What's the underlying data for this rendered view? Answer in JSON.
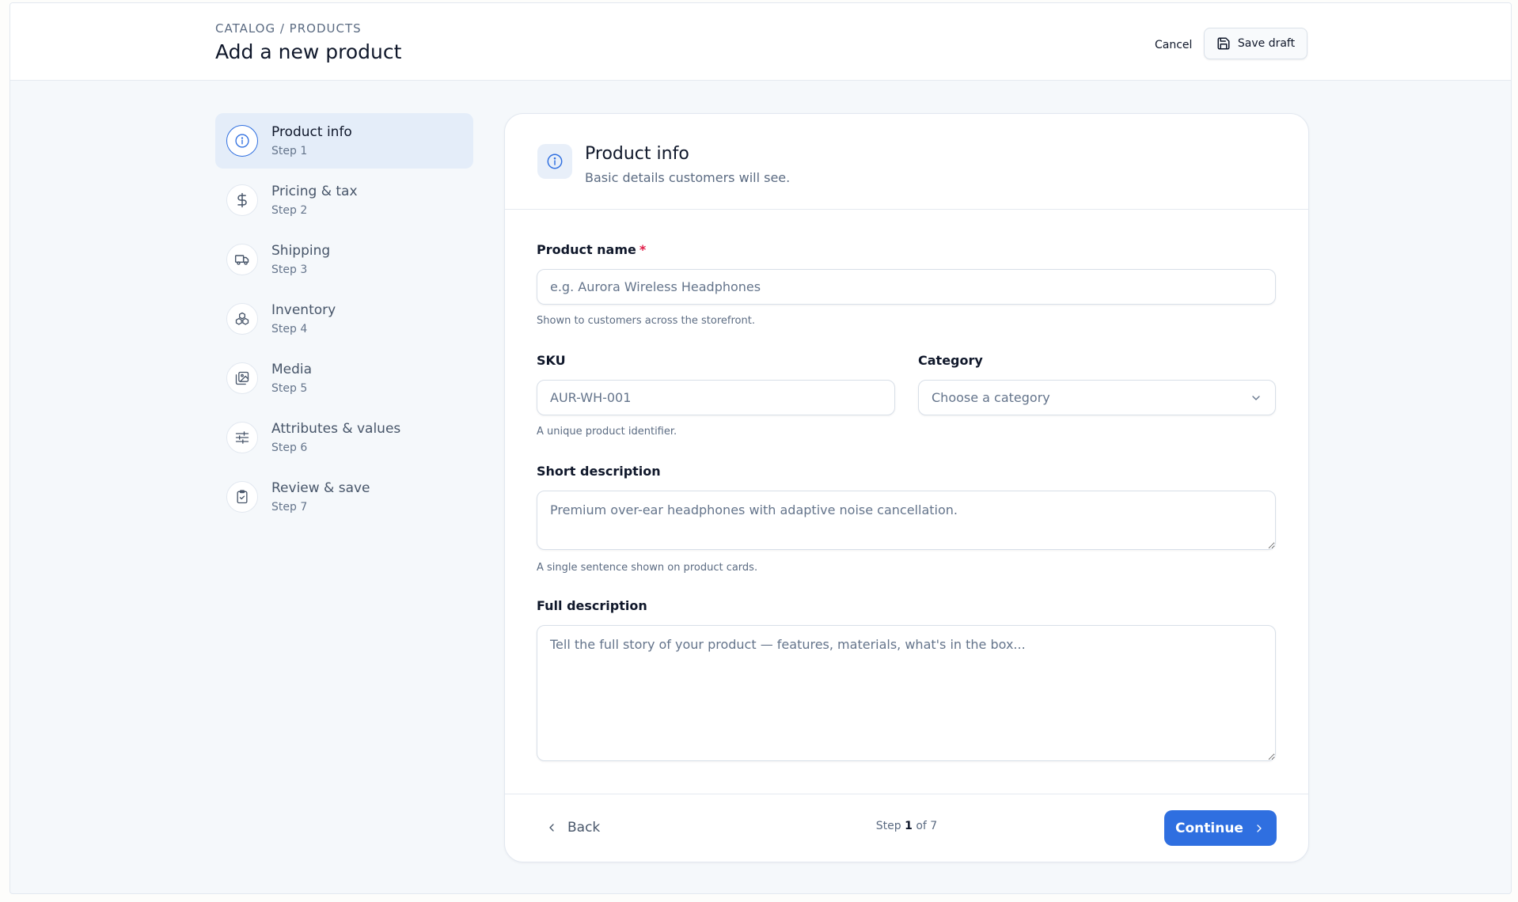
{
  "header": {
    "breadcrumb": "CATALOG / PRODUCTS",
    "title": "Add a new product",
    "cancel_label": "Cancel",
    "save_draft_label": "Save draft"
  },
  "steps": [
    {
      "title": "Product info",
      "sub": "Step 1",
      "icon": "info-icon",
      "active": true
    },
    {
      "title": "Pricing & tax",
      "sub": "Step 2",
      "icon": "dollar-icon",
      "active": false
    },
    {
      "title": "Shipping",
      "sub": "Step 3",
      "icon": "truck-icon",
      "active": false
    },
    {
      "title": "Inventory",
      "sub": "Step 4",
      "icon": "boxes-icon",
      "active": false
    },
    {
      "title": "Media",
      "sub": "Step 5",
      "icon": "images-icon",
      "active": false
    },
    {
      "title": "Attributes & values",
      "sub": "Step 6",
      "icon": "sliders-icon",
      "active": false
    },
    {
      "title": "Review & save",
      "sub": "Step 7",
      "icon": "clipboard-check-icon",
      "active": false
    }
  ],
  "card": {
    "title": "Product info",
    "subtitle": "Basic details customers will see."
  },
  "form": {
    "product_name": {
      "label": "Product name",
      "required_mark": "*",
      "value": "",
      "placeholder": "e.g. Aurora Wireless Headphones",
      "hint": "Shown to customers across the storefront."
    },
    "sku": {
      "label": "SKU",
      "value": "",
      "placeholder": "AUR-WH-001",
      "hint": "A unique product identifier."
    },
    "category": {
      "label": "Category",
      "selected": "Choose a category"
    },
    "short_description": {
      "label": "Short description",
      "value": "",
      "placeholder": "Premium over-ear headphones with adaptive noise cancellation.",
      "hint": "A single sentence shown on product cards."
    },
    "full_description": {
      "label": "Full description",
      "value": "",
      "placeholder": "Tell the full story of your product — features, materials, what's in the box..."
    }
  },
  "footer": {
    "back_label": "Back",
    "step_prefix": "Step",
    "step_current": "1",
    "step_suffix": "of 7",
    "continue_label": "Continue"
  },
  "colors": {
    "accent": "#2f6fe0",
    "active_step_bg": "#e4edf9",
    "required": "#e11d48"
  }
}
